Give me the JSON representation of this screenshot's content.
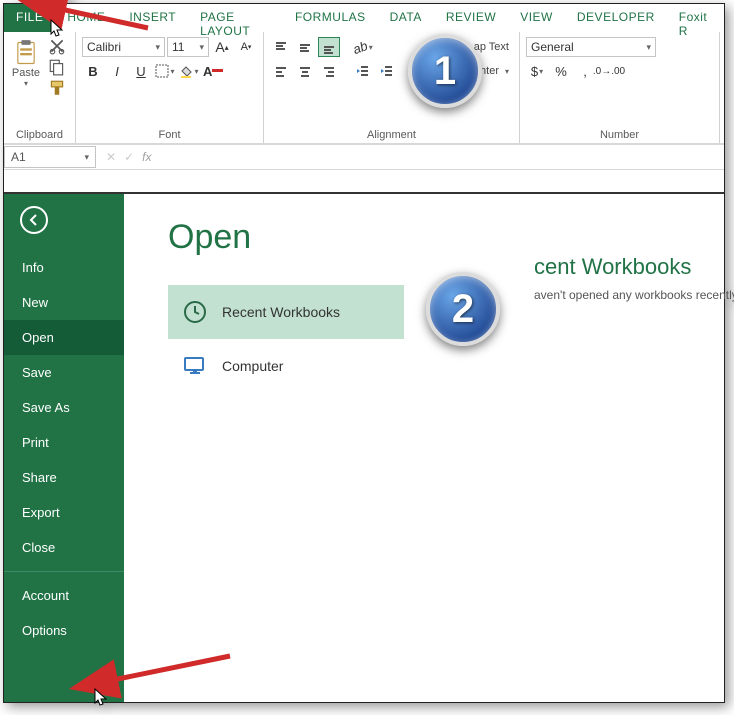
{
  "tabs": {
    "file": "FILE",
    "home": "HOME",
    "insert": "INSERT",
    "page_layout": "PAGE LAYOUT",
    "formulas": "FORMULAS",
    "data": "DATA",
    "review": "REVIEW",
    "view": "VIEW",
    "developer": "DEVELOPER",
    "foxit": "Foxit R"
  },
  "ribbon": {
    "clipboard": {
      "label": "Clipboard",
      "paste": "Paste"
    },
    "font": {
      "label": "Font",
      "name": "Calibri",
      "size": "11",
      "bold": "B",
      "italic": "I",
      "underline": "U"
    },
    "alignment": {
      "label": "Alignment",
      "wrap": "ap Text",
      "merge": "erge & Center"
    },
    "number": {
      "label": "Number",
      "format": "General"
    }
  },
  "formula_bar": {
    "name_box": "A1",
    "fx": "fx"
  },
  "backstage": {
    "title": "Open",
    "sidebar": [
      "Info",
      "New",
      "Open",
      "Save",
      "Save As",
      "Print",
      "Share",
      "Export",
      "Close",
      "Account",
      "Options"
    ],
    "sources": {
      "recent": "Recent Workbooks",
      "computer": "Computer"
    },
    "detail": {
      "title": "cent Workbooks",
      "body": "aven't opened any workbooks recently."
    }
  },
  "badges": {
    "one": "1",
    "two": "2"
  }
}
